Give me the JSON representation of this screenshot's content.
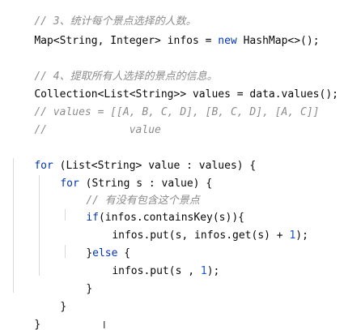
{
  "lines": {
    "c3": "// 3、统计每个景点选择的人数。",
    "map_a": "Map<String, Integer> infos = ",
    "map_new": "new",
    "map_b": " HashMap<>();",
    "c4": "// 4、提取所有人选择的景点的信息。",
    "coll": "Collection<List<String>> values = data.values();",
    "cvals": "// values = [[A, B, C, D], [B, C, D], [A, C]]",
    "cvalue": "//             value",
    "for1_kw": "for",
    "for1_rest": " (List<String> value : values) {",
    "for2_kw": "for",
    "for2_rest": " (String s : value) {",
    "c_contain": "// 有没有包含这个景点",
    "if_kw": "if",
    "if_rest": "(infos.containsKey(s)){",
    "put1_a": "infos.put(s, infos.get(s) + ",
    "put1_num": "1",
    "put1_b": ");",
    "else_a": "}",
    "else_kw": "else",
    "else_b": " {",
    "put2_a": "infos.put(s , ",
    "put2_num": "1",
    "put2_b": ");",
    "close_if": "}",
    "close_for2": "}",
    "close_for1": "}"
  },
  "cursor": "I"
}
